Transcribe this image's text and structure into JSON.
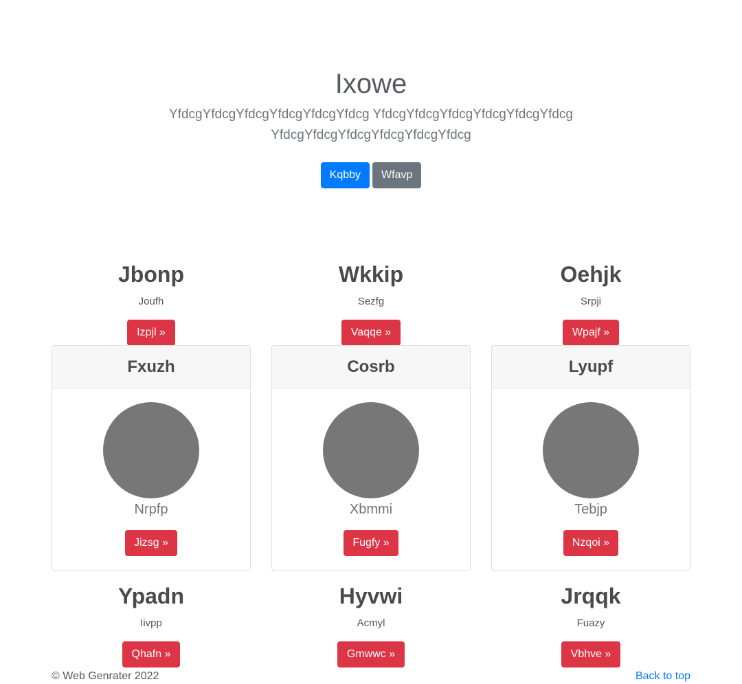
{
  "hero": {
    "title": "Ixowe",
    "lead": "YfdcgYfdcgYfdcgYfdcgYfdcgYfdcg YfdcgYfdcgYfdcgYfdcgYfdcgYfdcg YfdcgYfdcgYfdcgYfdcgYfdcgYfdcg",
    "primary_button": "Kqbby",
    "secondary_button": "Wfavp"
  },
  "features_top": [
    {
      "title": "Jbonp",
      "text": "Joufh",
      "button": "Izpjl »"
    },
    {
      "title": "Wkkip",
      "text": "Sezfg",
      "button": "Vaqqe »"
    },
    {
      "title": "Oehjk",
      "text": "Srpji",
      "button": "Wpajf »"
    }
  ],
  "cards": [
    {
      "header": "Fxuzh",
      "caption": "Nrpfp",
      "button": "Jizsg »"
    },
    {
      "header": "Cosrb",
      "caption": "Xbmmi",
      "button": "Fugfy »"
    },
    {
      "header": "Lyupf",
      "caption": "Tebjp",
      "button": "Nzqoi »"
    }
  ],
  "features_bottom": [
    {
      "title": "Ypadn",
      "text": "Iivpp",
      "button": "Qhafn »"
    },
    {
      "title": "Hyvwi",
      "text": "Acmyl",
      "button": "Gmwwc »"
    },
    {
      "title": "Jrqqk",
      "text": "Fuazy",
      "button": "Vbhve »"
    }
  ],
  "footer": {
    "copyright": "© Web Genrater 2022",
    "back_to_top": "Back to top"
  },
  "colors": {
    "primary": "#007bff",
    "secondary": "#6c757d",
    "danger": "#dc3545",
    "avatar_placeholder": "#777777"
  }
}
